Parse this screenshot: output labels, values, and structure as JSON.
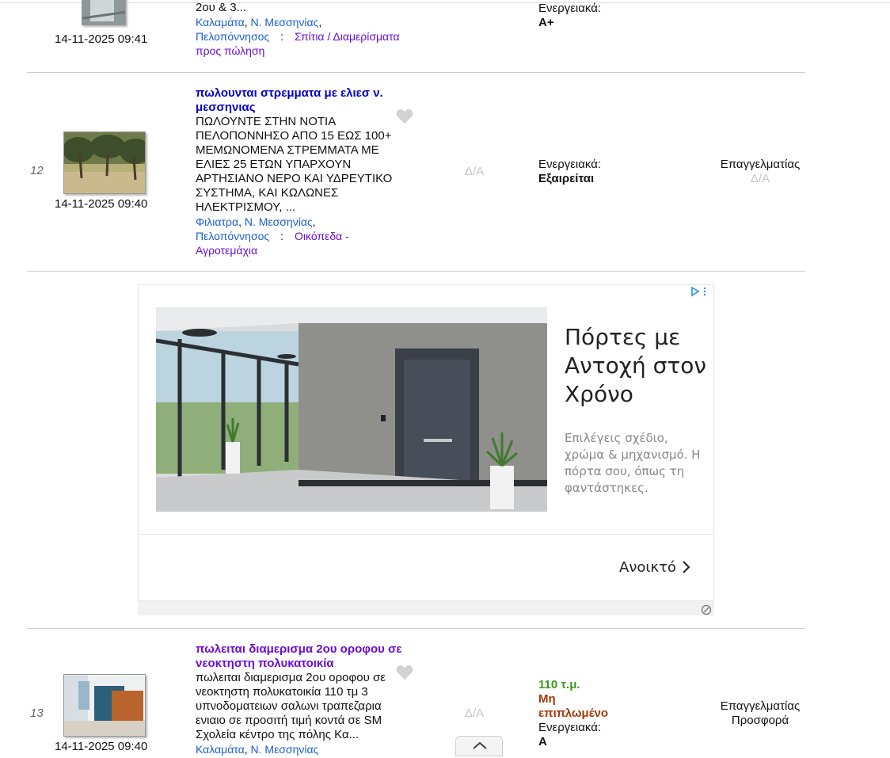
{
  "listings": [
    {
      "date": "14-11-2025 09:41",
      "desc_tail": "2ου & 3...",
      "loc_city": "Καλαμάτα",
      "loc_prefecture": "Ν. Μεσσηνίας",
      "loc_region": "Πελοπόννησος",
      "loc_sep": ":",
      "category_line1": "Σπίτια / Διαμερίσματα",
      "category_line2": "προς πώληση",
      "energy_label": "Ενεργειακά:",
      "energy_value": "A+"
    },
    {
      "num": "12",
      "date": "14-11-2025 09:40",
      "title": "πωλουνται στρεμματα με ελιεσ ν. μεσσηνιας",
      "description": "ΠΩΛΟΥΝΤΕ ΣΤΗΝ ΝΟΤΙΑ ΠΕΛΟΠΟΝΝΗΣΟ ΑΠΟ 15 ΕΩΣ 100+ ΜΕΜΩΝΟΜΕΝΑ ΣΤΡΕΜΜΑΤΑ ΜΕ ΕΛΙΕΣ 25 ΕΤΩΝ ΥΠΑΡΧΟΥΝ ΑΡΤΗΣΙΑΝΟ ΝΕΡΟ ΚΑΙ ΥΔΡΕΥΤΙΚΟ ΣΥΣΤΗΜΑ, ΚΑΙ ΚΩΛΩΝΕΣ ΗΛΕΚΤΡΙΣΜΟΥ, ...",
      "loc_city": "Φιλιατρα",
      "loc_prefecture": "Ν. Μεσσηνίας",
      "loc_region": "Πελοπόννησος",
      "loc_sep": ":",
      "category_line1": "Οικόπεδα -",
      "category_line2": "Αγροτεμάχια",
      "price": "Δ/Α",
      "energy_label": "Ενεργειακά:",
      "energy_value": "Εξαιρείται",
      "seller_type": "Επαγγελματίας",
      "seller_offer": "Δ/Α"
    },
    {
      "num": "13",
      "date": "14-11-2025 09:40",
      "title": "πωλειται διαμερισμα 2ου οροφου σε νεοκτηστη πολυκατοικία",
      "description": "πωλειται διαμερισμα 2ου οροφου σε νεοκτηστη πολυκατοικία 110 τμ 3 υπνοδοματειων σαλωνι τραπεζαρια ενιαιο σε προσιτή τιμή κοντά σε SM Σχολεία κέντρο της πόλης Κα...",
      "loc_city": "Καλαμάτα",
      "loc_prefecture": "Ν. Μεσσηνίας",
      "price": "Δ/Α",
      "area": "110 τ.μ.",
      "furnishing": "Μη επιπλωμένο",
      "energy_label": "Ενεργειακά:",
      "energy_value": "A",
      "seller_type": "Επαγγελματίας",
      "seller_offer": "Προσφορά"
    }
  ],
  "ad": {
    "headline": "Πόρτες με Αντοχή στον Χρόνο",
    "body": "Επιλέγεις σχέδιο, χρώμα & μηχανισμό. Η πόρτα σου, όπως τη φαντάστηκες.",
    "cta": "Ανοικτό"
  },
  "icons": {
    "favorite": "heart-icon",
    "ad_choices": "ad-choices-icon",
    "ad_feedback": "ad-feedback-icon",
    "scroll_up": "chevron-up-icon",
    "cta_arrow": "chevron-right-icon"
  },
  "colors": {
    "title_link": "#0000cc",
    "title_visited": "#6a0dd6",
    "location_link": "#1a5fd0",
    "area": "#3a9a1a",
    "furnishing": "#a33a0a",
    "not_available": "#c6c6c6"
  }
}
